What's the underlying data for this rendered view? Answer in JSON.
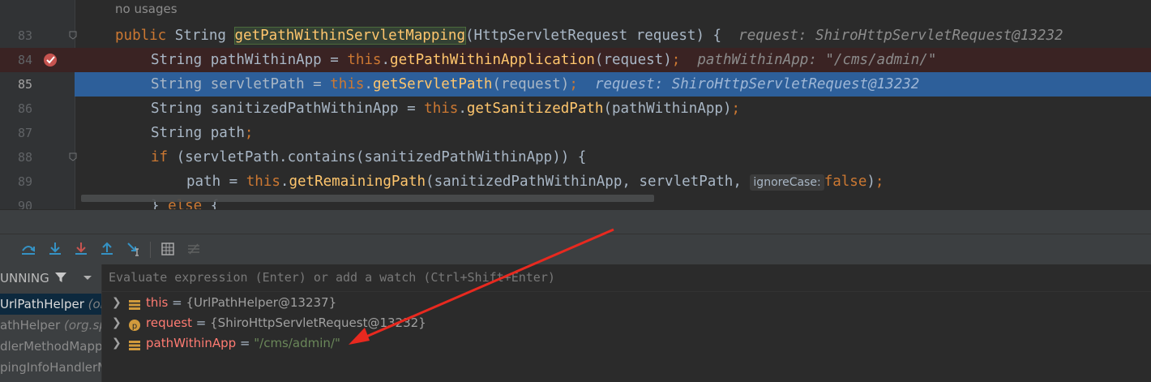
{
  "editor": {
    "usages_hint": "no usages",
    "lines": [
      {
        "num": "83",
        "kind": "sig"
      },
      {
        "num": "84",
        "kind": "bp"
      },
      {
        "num": "85",
        "kind": "cur"
      },
      {
        "num": "86",
        "kind": "normal"
      },
      {
        "num": "87",
        "kind": "normal"
      },
      {
        "num": "88",
        "kind": "normal"
      },
      {
        "num": "89",
        "kind": "normal"
      },
      {
        "num": "90",
        "kind": "normal"
      }
    ],
    "code": {
      "l83_kw": "public",
      "l83_type": " String ",
      "l83_method": "getPathWithinServletMapping",
      "l83_rest": "(HttpServletRequest request) {",
      "l83_hint": "request: ShiroHttpServletRequest@13232",
      "l84_a": "String pathWithinApp = ",
      "l84_this": "this",
      "l84_dot": ".",
      "l84_method": "getPathWithinApplication",
      "l84_rest": "(request)",
      "l84_semi": ";",
      "l84_hint": "pathWithinApp: \"/cms/admin/\"",
      "l85_a": "String servletPath = ",
      "l85_this": "this",
      "l85_dot": ".",
      "l85_method": "getServletPath",
      "l85_rest": "(request)",
      "l85_semi": ";",
      "l85_hint": "request: ShiroHttpServletRequest@13232",
      "l86_a": "String sanitizedPathWithinApp = ",
      "l86_this": "this",
      "l86_dot": ".",
      "l86_method": "getSanitizedPath",
      "l86_rest": "(pathWithinApp)",
      "l86_semi": ";",
      "l87_a": "String path",
      "l87_semi": ";",
      "l88_kw": "if",
      "l88_rest": " (servletPath.contains(sanitizedPathWithinApp)) {",
      "l89_a": "path = ",
      "l89_this": "this",
      "l89_dot": ".",
      "l89_method": "getRemainingPath",
      "l89_rest": "(sanitizedPathWithinApp, servletPath, ",
      "l89_param": "ignoreCase:",
      "l89_kw": "false",
      "l89_end": ")",
      "l89_semi": ";",
      "l90_a": "} ",
      "l90_kw": "else",
      "l90_rest": " {"
    }
  },
  "debugger": {
    "frames_header": "UNNING",
    "frames": [
      {
        "name": "UrlPathHelper",
        "pkg": "(org."
      },
      {
        "name": "athHelper",
        "pkg": "(org.sp"
      },
      {
        "name": "dlerMethodMapp",
        "pkg": ""
      },
      {
        "name": "pingInfoHandlerM",
        "pkg": ""
      }
    ],
    "watch_placeholder": "Evaluate expression (Enter) or add a watch (Ctrl+Shift+Enter)",
    "variables": [
      {
        "name": "this",
        "eq": " = ",
        "value": "{UrlPathHelper@13237}",
        "icon": "field-icon",
        "is_string": false
      },
      {
        "name": "request",
        "eq": " = ",
        "value": "{ShiroHttpServletRequest@13232}",
        "icon": "parameter-icon",
        "is_string": false
      },
      {
        "name": "pathWithinApp",
        "eq": " = ",
        "value": "\"/cms/admin/\"",
        "icon": "field-icon",
        "is_string": true
      }
    ]
  },
  "colors": {
    "keyword": "#cc7832",
    "method": "#ffc66d",
    "string": "#6a8759",
    "current_line": "#2d5f9a",
    "breakpoint_line": "#3a2323",
    "annotation_arrow": "#e8291f"
  }
}
